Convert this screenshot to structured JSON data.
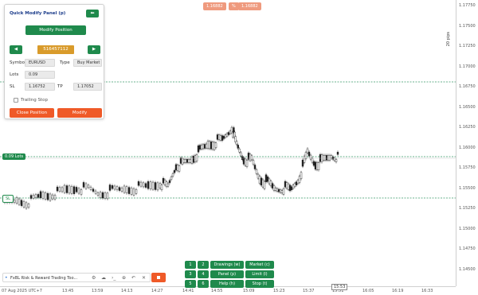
{
  "panel": {
    "title": "Quick Modify Panel (p)",
    "collapse_icon": "arrow-left-icon",
    "modify_position_label": "Modify Position",
    "ticket": "516457112",
    "prev_icon": "triangle-left-icon",
    "next_icon": "triangle-right-icon",
    "symbol_label": "Symbol",
    "symbol_value": "EURUSD",
    "type_label": "Type",
    "type_value": "Buy Market",
    "lots_label": "Lots",
    "lots_value": "0.09",
    "sl_label": "SL",
    "sl_value": "1.16752",
    "tp_label": "TP",
    "tp_value": "1.17052",
    "trailing_label": "Trailing Stop",
    "close_label": "Close Position",
    "modify_label": "Modify"
  },
  "top_buttons": [
    "1.16882",
    "%",
    "1.16882"
  ],
  "chart_labels": {
    "entry_line": "0.09 Lots",
    "sl_line": "SL",
    "tp_line": "TP",
    "vertical_label": "20 pips"
  },
  "colors": {
    "green": "#1f8a4c",
    "orange": "#ef5a28",
    "gold": "#d99b2b",
    "line_green": "#3a9a6a"
  },
  "chart_data": {
    "type": "candlestick",
    "ylim": [
      1.1645,
      1.1785
    ],
    "y_ticks": [
      "1.17750",
      "1.17500",
      "1.17250",
      "1.17000",
      "1.16750",
      "1.16500",
      "1.16250",
      "1.16000",
      "1.15750",
      "1.15500",
      "1.15250",
      "1.15000",
      "1.14750",
      "1.14500"
    ],
    "x_ticks": [
      "07 Aug 2025 UTC+7",
      "13:45",
      "13:59",
      "14:13",
      "14:27",
      "14:41",
      "14:55",
      "15:09",
      "15:23",
      "15:37",
      "15:51",
      "16:05",
      "16:19",
      "16:33"
    ],
    "current_time": "15:53"
  },
  "bottom_panel": {
    "row1": [
      "1",
      "2",
      "Drawings (w)",
      "Market (c)"
    ],
    "row2": [
      "3",
      "4",
      "Panel (p)",
      "Limit (l)"
    ],
    "row3": [
      "5",
      "6",
      "Help (h)",
      "Stop (t)"
    ]
  },
  "toolbar": {
    "text": "FxBL Risk & Reward Trading Too...",
    "icons": [
      "gear-icon",
      "cloud-icon",
      "terminal-icon",
      "plus-circle-icon",
      "undo-icon",
      "close-icon"
    ]
  }
}
